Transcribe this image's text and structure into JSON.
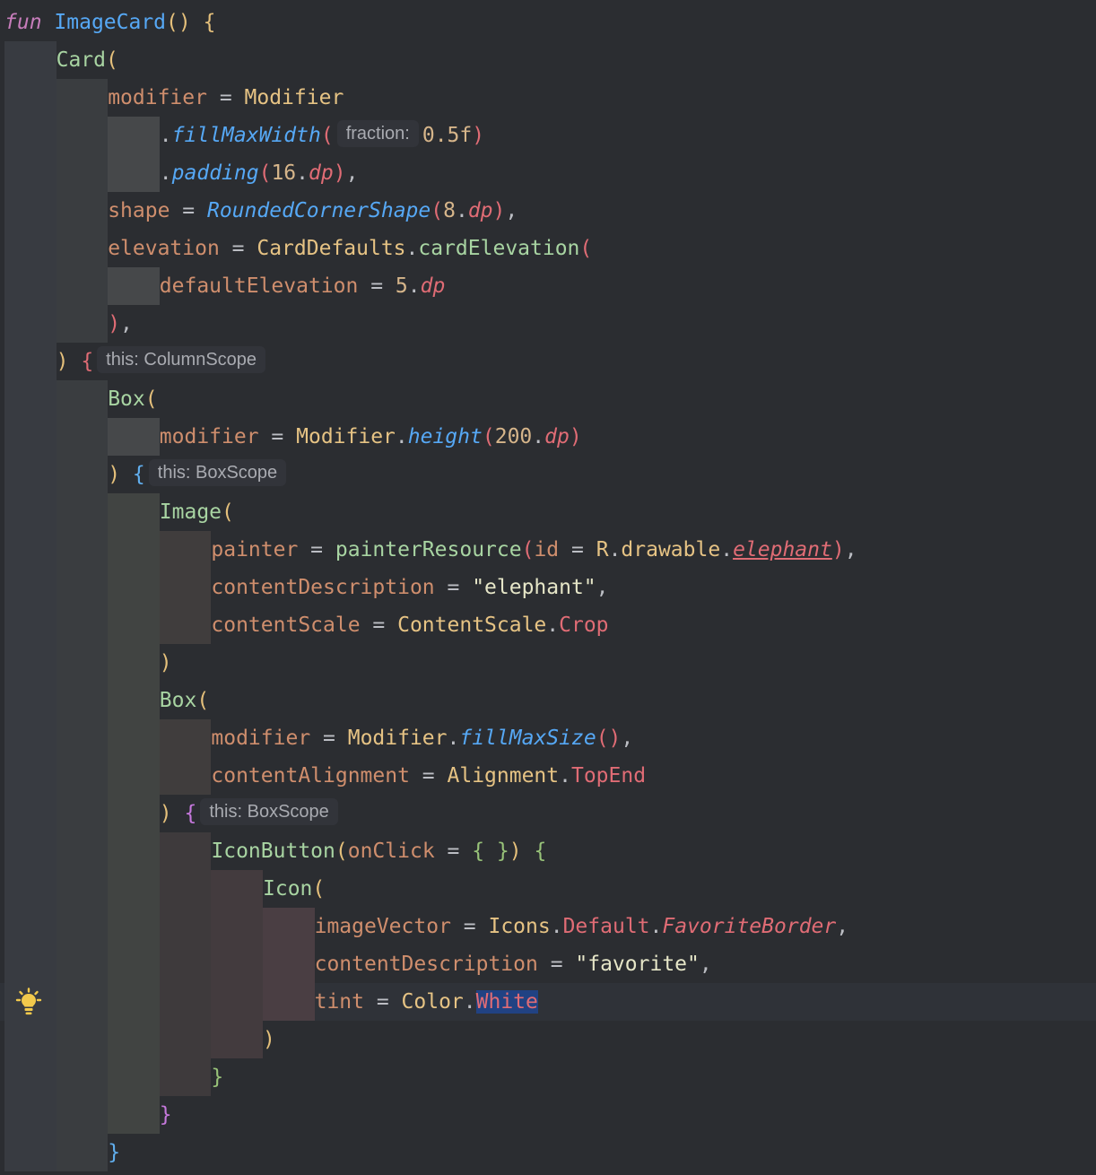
{
  "editor": {
    "language": "kotlin",
    "lines": [
      {
        "ind": 0,
        "caret": false,
        "tokens": [
          {
            "t": "fun",
            "c": "kw"
          },
          {
            "t": " ",
            "c": "txt"
          },
          {
            "t": "ImageCard",
            "c": "fn"
          },
          {
            "t": "()",
            "c": "p-y"
          },
          {
            "t": " ",
            "c": "txt"
          },
          {
            "t": "{",
            "c": "p-y"
          }
        ]
      },
      {
        "ind": 1,
        "caret": false,
        "tokens": [
          {
            "t": "Card",
            "c": "cls"
          },
          {
            "t": "(",
            "c": "p-y"
          }
        ]
      },
      {
        "ind": 2,
        "caret": false,
        "tokens": [
          {
            "t": "modifier",
            "c": "id"
          },
          {
            "t": " = ",
            "c": "txt"
          },
          {
            "t": "Modifier",
            "c": "typ"
          }
        ]
      },
      {
        "ind": 3,
        "caret": false,
        "tokens": [
          {
            "t": ".",
            "c": "txt"
          },
          {
            "t": "fillMaxWidth",
            "c": "ext"
          },
          {
            "t": "(",
            "c": "p-r"
          },
          {
            "hint": "fraction:"
          },
          {
            "t": "0.5f",
            "c": "num"
          },
          {
            "t": ")",
            "c": "p-r"
          }
        ]
      },
      {
        "ind": 3,
        "caret": false,
        "tokens": [
          {
            "t": ".",
            "c": "txt"
          },
          {
            "t": "padding",
            "c": "ext"
          },
          {
            "t": "(",
            "c": "p-r"
          },
          {
            "t": "16",
            "c": "num"
          },
          {
            "t": ".",
            "c": "txt"
          },
          {
            "t": "dp",
            "c": "unit"
          },
          {
            "t": ")",
            "c": "p-r"
          },
          {
            "t": ",",
            "c": "txt"
          }
        ]
      },
      {
        "ind": 2,
        "caret": false,
        "tokens": [
          {
            "t": "shape",
            "c": "id"
          },
          {
            "t": " = ",
            "c": "txt"
          },
          {
            "t": "RoundedCornerShape",
            "c": "ext"
          },
          {
            "t": "(",
            "c": "p-r"
          },
          {
            "t": "8",
            "c": "num"
          },
          {
            "t": ".",
            "c": "txt"
          },
          {
            "t": "dp",
            "c": "unit"
          },
          {
            "t": ")",
            "c": "p-r"
          },
          {
            "t": ",",
            "c": "txt"
          }
        ]
      },
      {
        "ind": 2,
        "caret": false,
        "tokens": [
          {
            "t": "elevation",
            "c": "id"
          },
          {
            "t": " = ",
            "c": "txt"
          },
          {
            "t": "CardDefaults",
            "c": "typ"
          },
          {
            "t": ".",
            "c": "txt"
          },
          {
            "t": "cardElevation",
            "c": "cls"
          },
          {
            "t": "(",
            "c": "p-r"
          }
        ]
      },
      {
        "ind": 3,
        "caret": false,
        "tokens": [
          {
            "t": "defaultElevation",
            "c": "id"
          },
          {
            "t": " = ",
            "c": "txt"
          },
          {
            "t": "5",
            "c": "num"
          },
          {
            "t": ".",
            "c": "txt"
          },
          {
            "t": "dp",
            "c": "unit"
          }
        ]
      },
      {
        "ind": 2,
        "caret": false,
        "tokens": [
          {
            "t": ")",
            "c": "p-r"
          },
          {
            "t": ",",
            "c": "txt"
          }
        ]
      },
      {
        "ind": 1,
        "caret": false,
        "tokens": [
          {
            "t": ")",
            "c": "p-y"
          },
          {
            "t": " ",
            "c": "txt"
          },
          {
            "t": "{",
            "c": "p-r"
          },
          {
            "hint": "this: ColumnScope"
          }
        ]
      },
      {
        "ind": 2,
        "caret": false,
        "tokens": [
          {
            "t": "Box",
            "c": "cls"
          },
          {
            "t": "(",
            "c": "p-y"
          }
        ]
      },
      {
        "ind": 3,
        "caret": false,
        "tokens": [
          {
            "t": "modifier",
            "c": "id"
          },
          {
            "t": " = ",
            "c": "txt"
          },
          {
            "t": "Modifier",
            "c": "typ"
          },
          {
            "t": ".",
            "c": "txt"
          },
          {
            "t": "height",
            "c": "ext"
          },
          {
            "t": "(",
            "c": "p-r"
          },
          {
            "t": "200",
            "c": "num"
          },
          {
            "t": ".",
            "c": "txt"
          },
          {
            "t": "dp",
            "c": "unit"
          },
          {
            "t": ")",
            "c": "p-r"
          }
        ]
      },
      {
        "ind": 2,
        "caret": false,
        "tokens": [
          {
            "t": ")",
            "c": "p-y"
          },
          {
            "t": " ",
            "c": "txt"
          },
          {
            "t": "{",
            "c": "p-b"
          },
          {
            "hint": "this: BoxScope"
          }
        ]
      },
      {
        "ind": 3,
        "caret": false,
        "tokens": [
          {
            "t": "Image",
            "c": "cls"
          },
          {
            "t": "(",
            "c": "p-y"
          }
        ]
      },
      {
        "ind": 4,
        "caret": false,
        "tokens": [
          {
            "t": "painter",
            "c": "id"
          },
          {
            "t": " = ",
            "c": "txt"
          },
          {
            "t": "painterResource",
            "c": "cls"
          },
          {
            "t": "(",
            "c": "p-r"
          },
          {
            "t": "id",
            "c": "id"
          },
          {
            "t": " = ",
            "c": "txt"
          },
          {
            "t": "R",
            "c": "typ"
          },
          {
            "t": ".",
            "c": "txt"
          },
          {
            "t": "drawable",
            "c": "typ"
          },
          {
            "t": ".",
            "c": "txt"
          },
          {
            "t": "elephant",
            "c": "prI und"
          },
          {
            "t": ")",
            "c": "p-r"
          },
          {
            "t": ",",
            "c": "txt"
          }
        ]
      },
      {
        "ind": 4,
        "caret": false,
        "tokens": [
          {
            "t": "contentDescription",
            "c": "id"
          },
          {
            "t": " = ",
            "c": "txt"
          },
          {
            "t": "\"elephant\"",
            "c": "str"
          },
          {
            "t": ",",
            "c": "txt"
          }
        ]
      },
      {
        "ind": 4,
        "caret": false,
        "tokens": [
          {
            "t": "contentScale",
            "c": "id"
          },
          {
            "t": " = ",
            "c": "txt"
          },
          {
            "t": "ContentScale",
            "c": "typ"
          },
          {
            "t": ".",
            "c": "txt"
          },
          {
            "t": "Crop",
            "c": "pr"
          }
        ]
      },
      {
        "ind": 3,
        "caret": false,
        "tokens": [
          {
            "t": ")",
            "c": "p-y"
          }
        ]
      },
      {
        "ind": 3,
        "caret": false,
        "tokens": [
          {
            "t": "Box",
            "c": "cls"
          },
          {
            "t": "(",
            "c": "p-y"
          }
        ]
      },
      {
        "ind": 4,
        "caret": false,
        "tokens": [
          {
            "t": "modifier",
            "c": "id"
          },
          {
            "t": " = ",
            "c": "txt"
          },
          {
            "t": "Modifier",
            "c": "typ"
          },
          {
            "t": ".",
            "c": "txt"
          },
          {
            "t": "fillMaxSize",
            "c": "ext"
          },
          {
            "t": "()",
            "c": "p-r"
          },
          {
            "t": ",",
            "c": "txt"
          }
        ]
      },
      {
        "ind": 4,
        "caret": false,
        "tokens": [
          {
            "t": "contentAlignment",
            "c": "id"
          },
          {
            "t": " = ",
            "c": "txt"
          },
          {
            "t": "Alignment",
            "c": "typ"
          },
          {
            "t": ".",
            "c": "txt"
          },
          {
            "t": "TopEnd",
            "c": "pr"
          }
        ]
      },
      {
        "ind": 3,
        "caret": false,
        "tokens": [
          {
            "t": ")",
            "c": "p-y"
          },
          {
            "t": " ",
            "c": "txt"
          },
          {
            "t": "{",
            "c": "p-p"
          },
          {
            "hint": "this: BoxScope"
          }
        ]
      },
      {
        "ind": 4,
        "caret": false,
        "tokens": [
          {
            "t": "IconButton",
            "c": "cls"
          },
          {
            "t": "(",
            "c": "p-y"
          },
          {
            "t": "onClick",
            "c": "id"
          },
          {
            "t": " = ",
            "c": "txt"
          },
          {
            "t": "{ }",
            "c": "p-g"
          },
          {
            "t": ")",
            "c": "p-y"
          },
          {
            "t": " ",
            "c": "txt"
          },
          {
            "t": "{",
            "c": "p-g"
          }
        ]
      },
      {
        "ind": 5,
        "caret": false,
        "tokens": [
          {
            "t": "Icon",
            "c": "cls"
          },
          {
            "t": "(",
            "c": "p-y"
          }
        ]
      },
      {
        "ind": 6,
        "caret": false,
        "tokens": [
          {
            "t": "imageVector",
            "c": "id"
          },
          {
            "t": " = ",
            "c": "txt"
          },
          {
            "t": "Icons",
            "c": "typ"
          },
          {
            "t": ".",
            "c": "txt"
          },
          {
            "t": "Default",
            "c": "pr"
          },
          {
            "t": ".",
            "c": "txt"
          },
          {
            "t": "FavoriteBorder",
            "c": "prI"
          },
          {
            "t": ",",
            "c": "txt"
          }
        ]
      },
      {
        "ind": 6,
        "caret": false,
        "tokens": [
          {
            "t": "contentDescription",
            "c": "id"
          },
          {
            "t": " = ",
            "c": "txt"
          },
          {
            "t": "\"favorite\"",
            "c": "str"
          },
          {
            "t": ",",
            "c": "txt"
          }
        ]
      },
      {
        "ind": 6,
        "caret": true,
        "tokens": [
          {
            "t": "tint",
            "c": "id"
          },
          {
            "t": " = ",
            "c": "txt"
          },
          {
            "t": "Color",
            "c": "typ"
          },
          {
            "t": ".",
            "c": "txt"
          },
          {
            "t": "White",
            "c": "pr sel"
          }
        ]
      },
      {
        "ind": 5,
        "caret": false,
        "tokens": [
          {
            "t": ")",
            "c": "p-y"
          }
        ]
      },
      {
        "ind": 4,
        "caret": false,
        "tokens": [
          {
            "t": "}",
            "c": "p-g"
          }
        ]
      },
      {
        "ind": 3,
        "caret": false,
        "tokens": [
          {
            "t": "}",
            "c": "p-p"
          }
        ]
      },
      {
        "ind": 2,
        "caret": false,
        "tokens": [
          {
            "t": "}",
            "c": "p-b"
          }
        ]
      }
    ]
  },
  "indent_guides": [
    {
      "level": 1,
      "from": 1,
      "to": 30,
      "color": "#383b41"
    },
    {
      "level": 2,
      "from": 2,
      "to": 8,
      "color": "#3a3d40"
    },
    {
      "level": 2,
      "from": 10,
      "to": 30,
      "color": "#3a3d40"
    },
    {
      "level": 3,
      "from": 3,
      "to": 4,
      "color": "#46484a"
    },
    {
      "level": 3,
      "from": 7,
      "to": 7,
      "color": "#46484a"
    },
    {
      "level": 3,
      "from": 11,
      "to": 11,
      "color": "#46484a"
    },
    {
      "level": 3,
      "from": 13,
      "to": 29,
      "color": "#414442"
    },
    {
      "level": 4,
      "from": 14,
      "to": 16,
      "color": "#403d3d"
    },
    {
      "level": 4,
      "from": 19,
      "to": 20,
      "color": "#403d3d"
    },
    {
      "level": 4,
      "from": 22,
      "to": 28,
      "color": "#3e3a3c"
    },
    {
      "level": 5,
      "from": 23,
      "to": 27,
      "color": "#433b3e"
    },
    {
      "level": 6,
      "from": 24,
      "to": 26,
      "color": "#4a3e43"
    }
  ],
  "gutter": {
    "bulb_icon": "lightbulb-icon",
    "bulb_line": 26
  }
}
